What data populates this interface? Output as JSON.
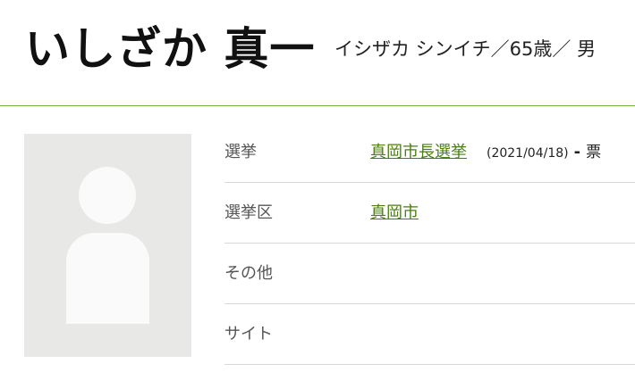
{
  "profile": {
    "name": "いしざか 真一",
    "reading": "イシザカ シンイチ／65歳／ 男"
  },
  "photo": {
    "icon": "person-silhouette-icon"
  },
  "rows": {
    "election": {
      "label": "選挙",
      "link": "真岡市長選挙",
      "date": "(2021/04/18)",
      "dash": "-",
      "votes": "票"
    },
    "district": {
      "label": "選挙区",
      "link": "真岡市"
    },
    "other": {
      "label": "その他"
    },
    "site": {
      "label": "サイト"
    }
  },
  "colors": {
    "accent": "#7cb342",
    "link": "#4a7d12",
    "photo_bg": "#e8e8e6"
  }
}
